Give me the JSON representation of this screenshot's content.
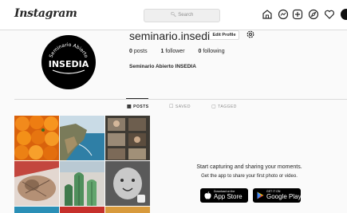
{
  "topbar": {
    "logo": "Instagram",
    "search_placeholder": "Search",
    "icons": [
      "home-icon",
      "messenger-icon",
      "new-post-icon",
      "explore-icon",
      "activity-heart-icon"
    ]
  },
  "profile": {
    "username": "seminario.insedia",
    "edit_label": "Edit Profile",
    "posts_count": "0",
    "posts_label": "posts",
    "followers_count": "1",
    "followers_label": "follower",
    "following_count": "0",
    "following_label": "following",
    "full_name": "Seminario Abierto INSEDIA",
    "avatar_text_top": "Seminario Abierto",
    "avatar_text_main": "INSEDIA"
  },
  "tabs": [
    {
      "label": "POSTS",
      "active": true
    },
    {
      "label": "SAVED",
      "active": false
    },
    {
      "label": "TAGGED",
      "active": false
    }
  ],
  "promo": {
    "title": "Start capturing and sharing your moments.",
    "subtitle": "Get the app to share your first photo or video.",
    "app_store_small": "Download on the",
    "app_store_big": "App Store",
    "google_play_small": "GET IT ON",
    "google_play_big": "Google Play"
  },
  "grid": {
    "photos": [
      "oranges-photo",
      "coastline-photo",
      "photobooth-photo",
      "cat-photo",
      "cactus-photo",
      "baby-photo"
    ]
  }
}
